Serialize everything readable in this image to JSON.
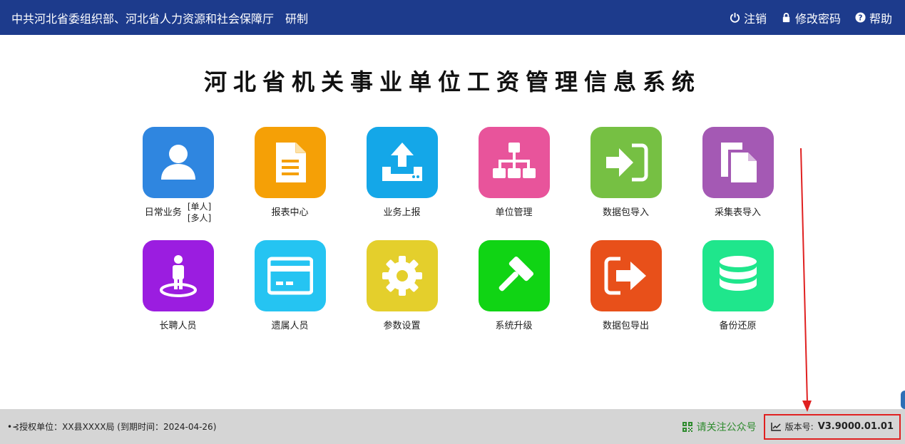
{
  "header": {
    "org_text": "中共河北省委组织部、河北省人力资源和社会保障厅",
    "made_by": "研制",
    "logout": "注销",
    "change_password": "修改密码",
    "help": "帮助"
  },
  "page_title": "河北省机关事业单位工资管理信息系统",
  "tiles": [
    {
      "label": "日常业务",
      "sub1": "[单人]",
      "sub2": "[多人]",
      "color": "#2f86e0",
      "icon": "user-icon"
    },
    {
      "label": "报表中心",
      "color": "#f5a006",
      "icon": "document-icon"
    },
    {
      "label": "业务上报",
      "color": "#14a7e8",
      "icon": "upload-icon"
    },
    {
      "label": "单位管理",
      "color": "#e8549b",
      "icon": "org-chart-icon"
    },
    {
      "label": "数据包导入",
      "color": "#76c043",
      "icon": "import-icon"
    },
    {
      "label": "采集表导入",
      "color": "#a459b4",
      "icon": "copy-icon"
    },
    {
      "label": "长聘人员",
      "color": "#9b1de0",
      "icon": "person-standing-icon"
    },
    {
      "label": "遗属人员",
      "color": "#25c4f2",
      "icon": "card-icon"
    },
    {
      "label": "参数设置",
      "color": "#e4cf2c",
      "icon": "gear-icon"
    },
    {
      "label": "系统升级",
      "color": "#10d414",
      "icon": "gavel-icon"
    },
    {
      "label": "数据包导出",
      "color": "#e8501a",
      "icon": "export-icon"
    },
    {
      "label": "备份还原",
      "color": "#1fe68c",
      "icon": "database-icon"
    }
  ],
  "footer": {
    "license": "•⊰授权单位：XX县XXXX局 (到期时间：2024-04-26)",
    "follow": "请关注公众号",
    "version_label": "版本号:",
    "version_value": "V3.9000.01.01"
  }
}
